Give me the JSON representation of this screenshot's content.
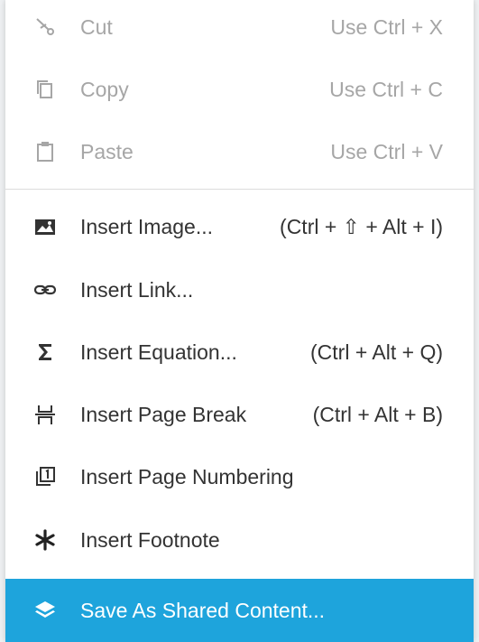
{
  "menu": {
    "items": [
      {
        "label": "Cut",
        "shortcut": "Use Ctrl + X",
        "icon": "scissors-icon",
        "disabled": true
      },
      {
        "label": "Copy",
        "shortcut": "Use Ctrl + C",
        "icon": "copy-icon",
        "disabled": true
      },
      {
        "label": "Paste",
        "shortcut": "Use Ctrl + V",
        "icon": "clipboard-icon",
        "disabled": true
      },
      {
        "label": "Insert Image...",
        "shortcut": "(Ctrl + ⇧ + Alt + I)",
        "icon": "image-icon"
      },
      {
        "label": "Insert Link...",
        "shortcut": "",
        "icon": "link-icon"
      },
      {
        "label": "Insert Equation...",
        "shortcut": "(Ctrl + Alt + Q)",
        "icon": "sigma-icon"
      },
      {
        "label": "Insert Page Break",
        "shortcut": "(Ctrl + Alt + B)",
        "icon": "page-break-icon"
      },
      {
        "label": "Insert Page Numbering",
        "shortcut": "",
        "icon": "page-number-icon"
      },
      {
        "label": "Insert Footnote",
        "shortcut": "",
        "icon": "asterisk-icon"
      },
      {
        "label": "Save As Shared Content...",
        "shortcut": "",
        "icon": "layers-icon",
        "highlighted": true
      }
    ]
  },
  "colors": {
    "highlight": "#1ea4dc",
    "disabled_text": "#a6a6a6",
    "text": "#333333"
  }
}
